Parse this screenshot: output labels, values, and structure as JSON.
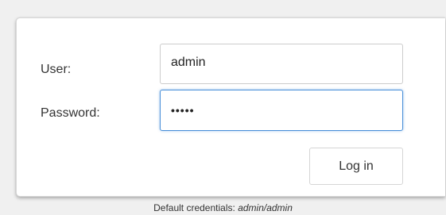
{
  "login_form": {
    "user_label": "User:",
    "user_value": "admin",
    "password_label": "Password:",
    "password_value": "•••••",
    "submit_label": "Log in"
  },
  "hint": {
    "prefix": "Default credentials:",
    "credentials": "admin/admin"
  },
  "colors": {
    "focus_border": "#4a90d9",
    "background": "#f0f0f0",
    "card": "#ffffff"
  }
}
